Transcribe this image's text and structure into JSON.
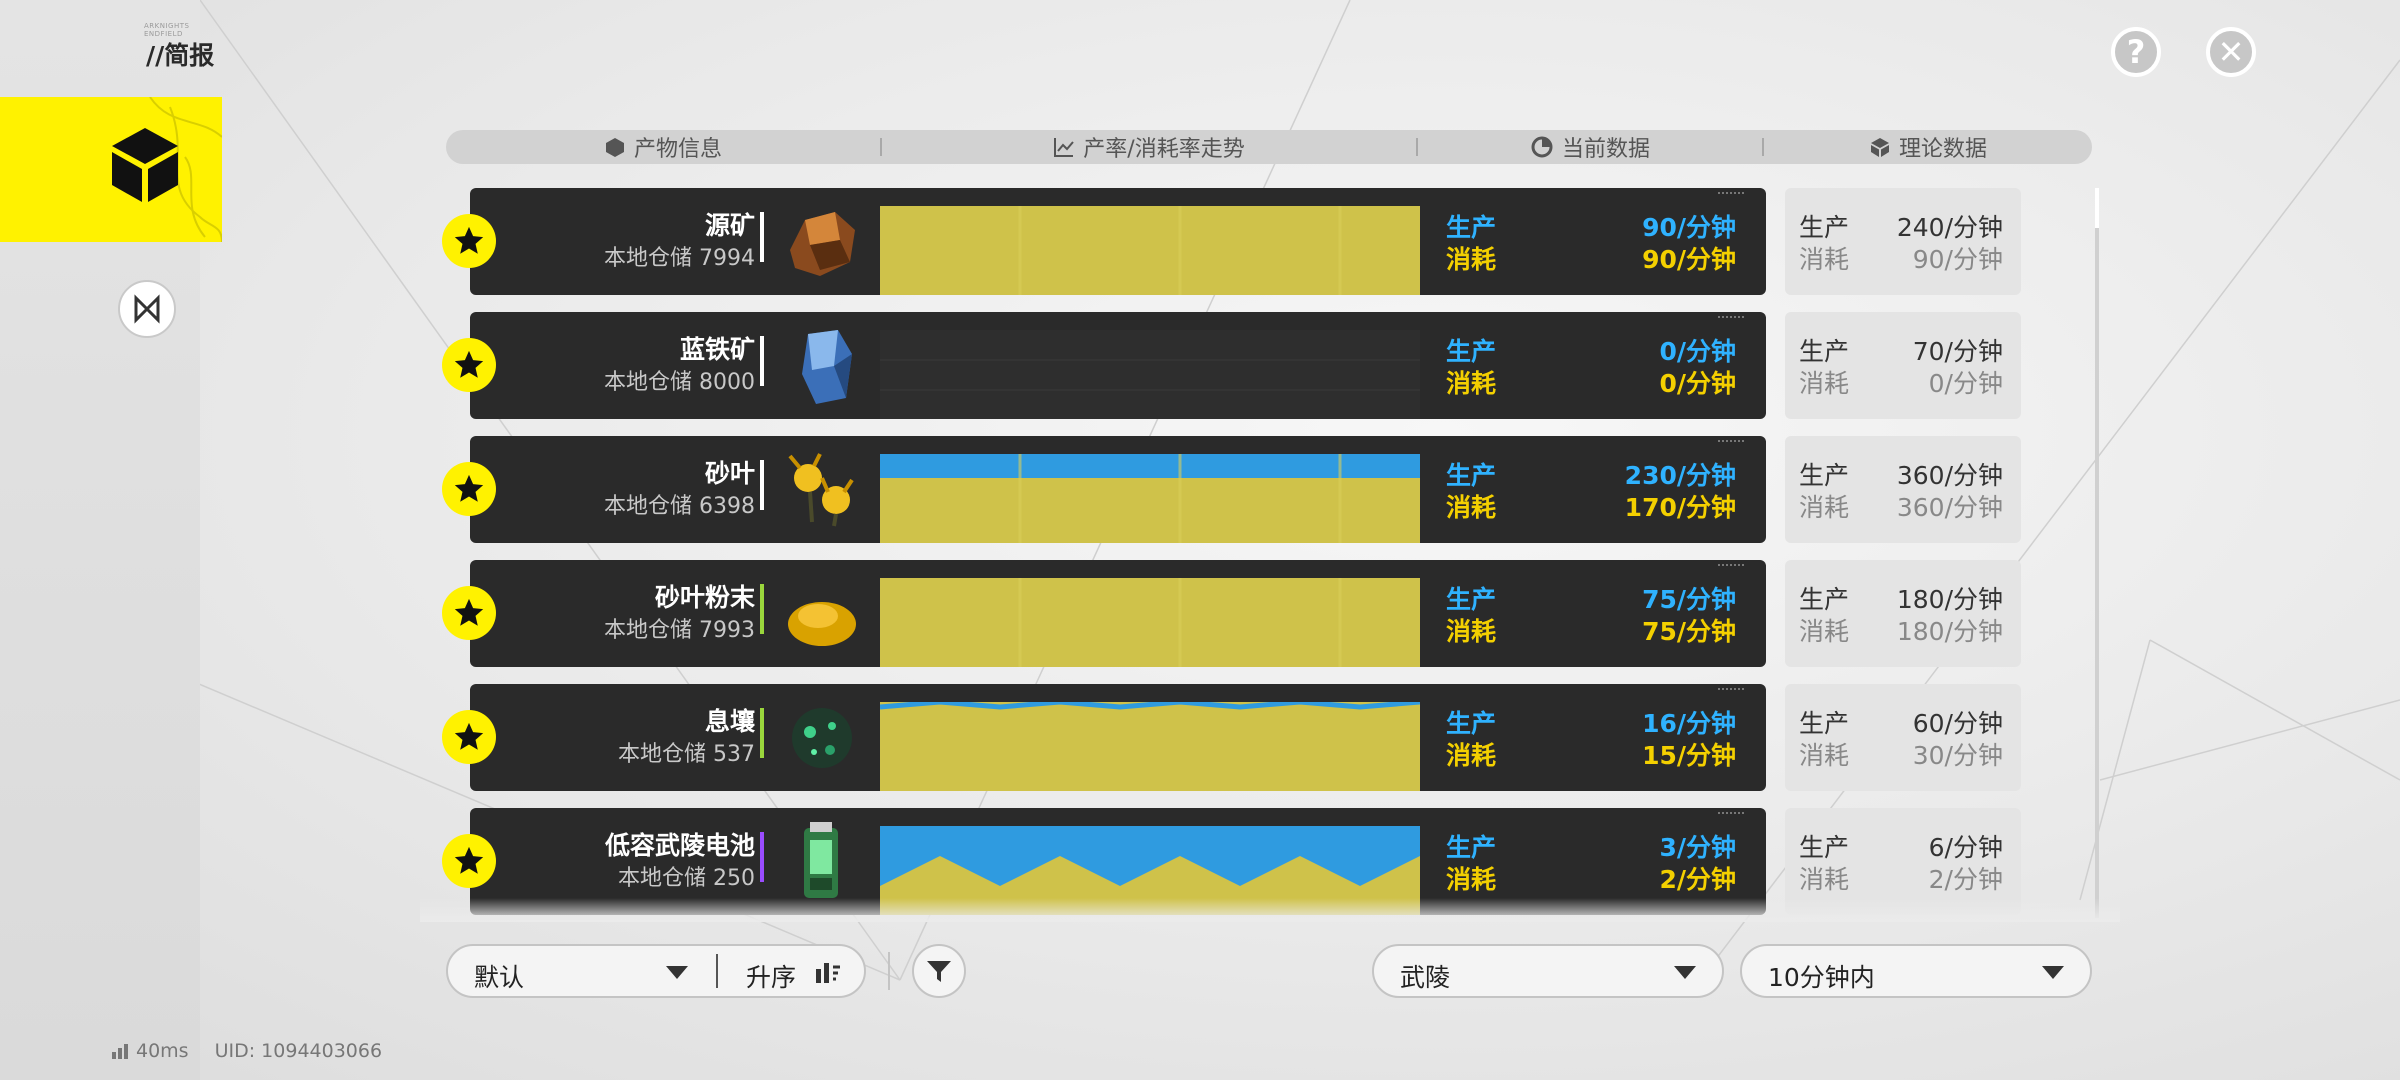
{
  "header": {
    "brand_text": "ARKNIGHTS ENDFIELD",
    "title": "//简报",
    "help_label": "?",
    "close_label": "✕"
  },
  "columns": [
    "产物信息",
    "产率/消耗率走势",
    "当前数据",
    "理论数据"
  ],
  "labels": {
    "produce": "生产",
    "consume": "消耗",
    "stock_prefix": "本地仓储"
  },
  "rows": [
    {
      "name": "源矿",
      "stock": "本地仓储 7994",
      "rarity_color": "#ffffff",
      "icon": "originium-ore-icon",
      "cur_prod": "90/分钟",
      "cur_cons": "90/分钟",
      "theo_prod": "240/分钟",
      "theo_cons": "90/分钟",
      "prod_level": 0.0,
      "cons_level": 1.0
    },
    {
      "name": "蓝铁矿",
      "stock": "本地仓储 8000",
      "rarity_color": "#ffffff",
      "icon": "blue-iron-ore-icon",
      "cur_prod": "0/分钟",
      "cur_cons": "0/分钟",
      "theo_prod": "70/分钟",
      "theo_cons": "0/分钟",
      "prod_level": 0.0,
      "cons_level": 0.0
    },
    {
      "name": "砂叶",
      "stock": "本地仓储 6398",
      "rarity_color": "#ffffff",
      "icon": "sandleaf-icon",
      "cur_prod": "230/分钟",
      "cur_cons": "170/分钟",
      "theo_prod": "360/分钟",
      "theo_cons": "360/分钟",
      "prod_level": 1.0,
      "cons_level": 0.74
    },
    {
      "name": "砂叶粉末",
      "stock": "本地仓储 7993",
      "rarity_color": "#9ad63c",
      "icon": "sandleaf-powder-icon",
      "cur_prod": "75/分钟",
      "cur_cons": "75/分钟",
      "theo_prod": "180/分钟",
      "theo_cons": "180/分钟",
      "prod_level": 0.0,
      "cons_level": 1.0
    },
    {
      "name": "息壤",
      "stock": "本地仓储 537",
      "rarity_color": "#9ad63c",
      "icon": "xirang-icon",
      "cur_prod": "16/分钟",
      "cur_cons": "15/分钟",
      "theo_prod": "60/分钟",
      "theo_cons": "30/分钟",
      "prod_level": 1.0,
      "cons_level": 0.94
    },
    {
      "name": "低容武陵电池",
      "stock": "本地仓储 250",
      "rarity_color": "#9a4cff",
      "icon": "wuling-battery-icon",
      "cur_prod": "3/分钟",
      "cur_cons": "2/分钟",
      "theo_prod": "6/分钟",
      "theo_cons": "2/分钟",
      "prod_level": 1.0,
      "cons_level": 0.67
    }
  ],
  "controls": {
    "sort_select": "默认",
    "order_label": "升序",
    "region_select": "武陵",
    "time_select": "10分钟内"
  },
  "status": {
    "ping": "40ms",
    "uid": "UID: 1094403066"
  },
  "colors": {
    "accent": "#fff200",
    "produce": "#2fb2ff",
    "consume": "#f4d000",
    "row_bg": "#2a2a2a"
  }
}
